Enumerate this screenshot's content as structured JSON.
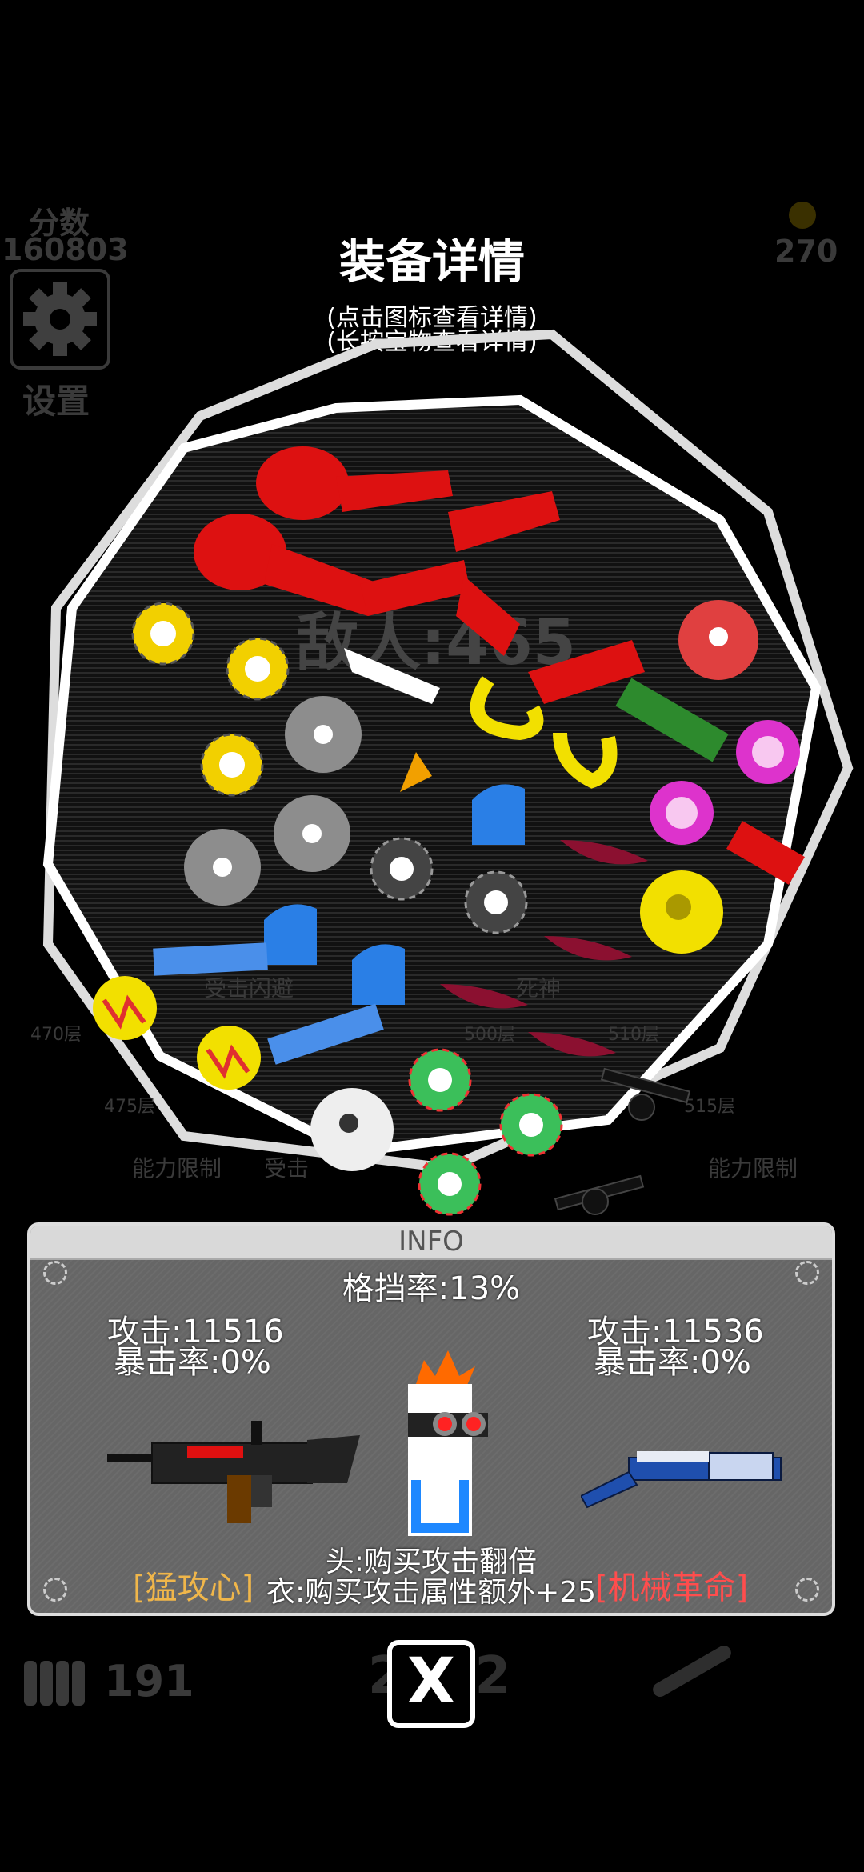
{
  "hud": {
    "score_label": "分数",
    "score_value": "160803",
    "coins_value": "270",
    "settings_label": "设置",
    "ammo_value": "191",
    "bg_number": "2022"
  },
  "modal": {
    "title": "装备详情",
    "hint_tap": "(点击图标查看详情)",
    "hint_hold": "(长按宝物查看详情)"
  },
  "arena": {
    "enemy_label": "敌人:465",
    "bg_labels": [
      "受击闪避",
      "死神",
      "能力限制",
      "受击",
      "能力限制"
    ],
    "bg_floors": [
      "470层",
      "475层",
      "500层",
      "510层",
      "515层"
    ]
  },
  "info": {
    "title": "INFO",
    "block_rate": "格挡率:13%",
    "left": {
      "attack": "攻击:11516",
      "crit": "暴击率:0%",
      "name": "[猛攻心]",
      "name_color": "#f0b64a"
    },
    "right": {
      "attack": "攻击:11536",
      "crit": "暴击率:0%",
      "name": "[机械革命]",
      "name_color": "#ff4d4d"
    },
    "head_bonus": "头:购买攻击翻倍",
    "body_bonus": "衣:购买攻击属性额外+25"
  },
  "close_label": "X",
  "colors": {
    "red": "#dd1111",
    "yellow": "#f2e000",
    "blue": "#2a7fe6",
    "green": "#2d8a2d",
    "pink": "#ee88dd"
  }
}
